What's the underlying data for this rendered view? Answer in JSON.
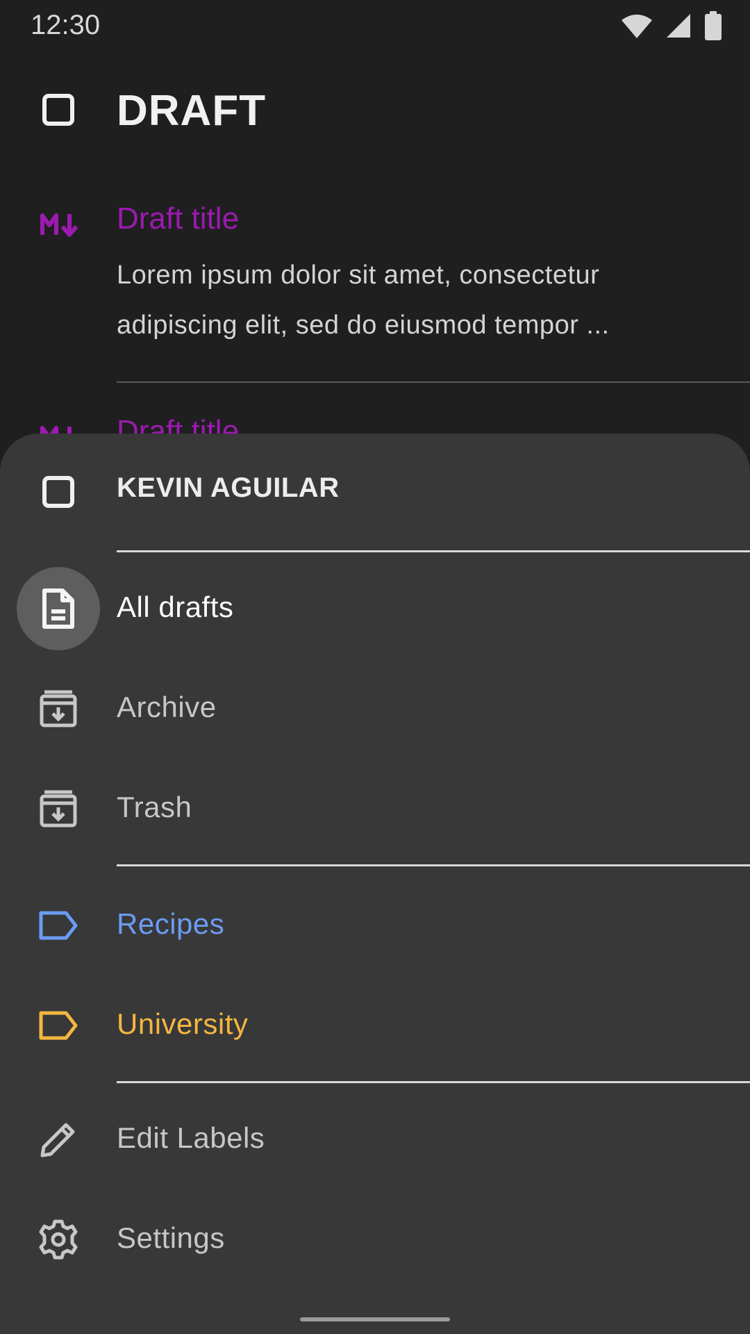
{
  "status_bar": {
    "time": "12:30",
    "icons": [
      "wifi-icon",
      "signal-icon",
      "battery-icon"
    ]
  },
  "header": {
    "title": "DRAFT",
    "icon": "checkbox-outline-icon"
  },
  "drafts": [
    {
      "icon": "markdown-icon",
      "title": "Draft title",
      "body": "Lorem ipsum dolor sit amet, consectetur adipiscing elit, sed do eiusmod tempor ..."
    },
    {
      "icon": "markdown-icon",
      "title": "Draft title"
    }
  ],
  "drawer": {
    "account": {
      "name": "KEVIN AGUILAR",
      "icon": "checkbox-outline-icon"
    },
    "items": [
      {
        "label": "All drafts",
        "icon": "document-icon",
        "active": true
      },
      {
        "label": "Archive",
        "icon": "archive-icon",
        "active": false
      },
      {
        "label": "Trash",
        "icon": "archive-icon",
        "active": false
      }
    ],
    "labels": [
      {
        "label": "Recipes",
        "icon": "label-icon",
        "color": "#6b9cf2"
      },
      {
        "label": "University",
        "icon": "label-icon",
        "color": "#f4b73e"
      }
    ],
    "actions": [
      {
        "label": "Edit Labels",
        "icon": "pencil-icon"
      },
      {
        "label": "Settings",
        "icon": "gear-icon"
      }
    ]
  },
  "colors": {
    "background": "#1f1f20",
    "drawer": "#383839",
    "draft_title": "#9c1ab1",
    "active_item_bg": "#5e5e5e"
  }
}
